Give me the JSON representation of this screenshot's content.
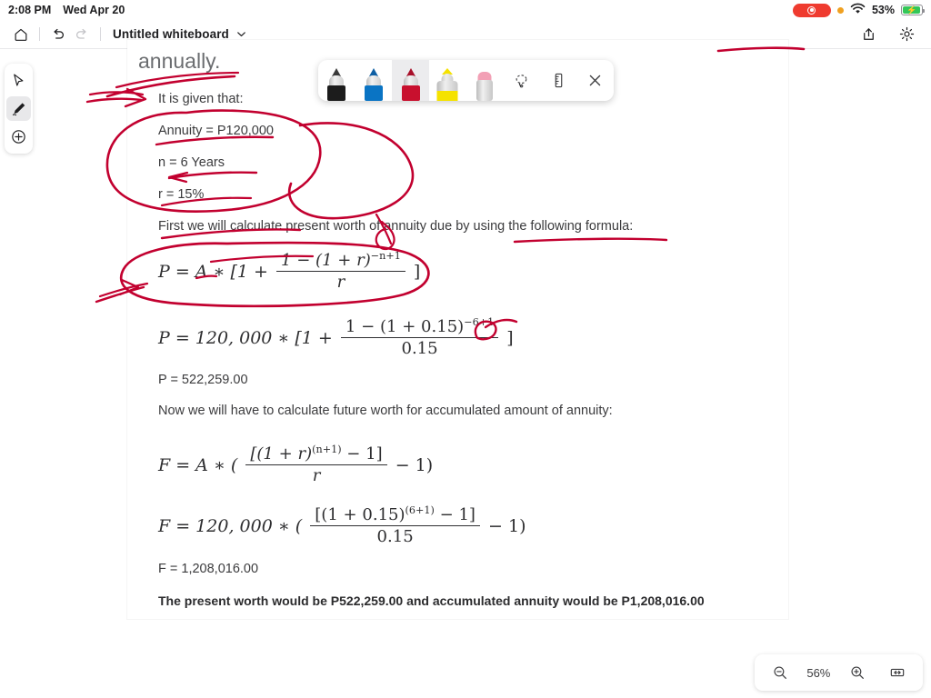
{
  "status_bar": {
    "time": "2:08 PM",
    "date": "Wed Apr 20",
    "battery_percent": "53%",
    "recording_icon": "screen-recording-indicator",
    "wifi_icon": "wifi-icon",
    "orange_dot_icon": "microphone-in-use-indicator",
    "battery_icon": "battery-charging-icon"
  },
  "app_toolbar": {
    "home_icon": "home-icon",
    "undo_icon": "undo-icon",
    "redo_icon": "redo-icon",
    "title": "Untitled whiteboard",
    "title_chevron_icon": "chevron-down-icon",
    "share_icon": "share-icon",
    "settings_icon": "gear-icon"
  },
  "tool_rail": {
    "items": [
      {
        "name": "select-tool",
        "icon": "cursor-arrow-icon",
        "active": false
      },
      {
        "name": "pen-tool",
        "icon": "pen-icon",
        "active": true
      },
      {
        "name": "add-tool",
        "icon": "plus-circle-icon",
        "active": false
      }
    ]
  },
  "pen_toolbar": {
    "pens": [
      {
        "label": "black-pen",
        "color": "#1c1c1c",
        "selected": false
      },
      {
        "label": "blue-pen",
        "color": "#0a74c4",
        "selected": false
      },
      {
        "label": "red-pen",
        "color": "#c8102e",
        "selected": true
      },
      {
        "label": "yellow-highlighter",
        "color": "#f5e200",
        "selected": false
      },
      {
        "label": "pink-eraser",
        "color": "#f2a0b5",
        "selected": false
      }
    ],
    "lasso_icon": "lasso-select-icon",
    "ruler_icon": "ruler-icon",
    "close_icon": "close-icon"
  },
  "document": {
    "heading_fragment": "annually.",
    "given_label": "It is given that:",
    "given": [
      "Annuity = P120,000",
      "n = 6 Years",
      "r = 15%"
    ],
    "present_worth_intro": "First we will calculate present worth of annuity due by using the following formula:",
    "formula_present_general": {
      "lhs": "P = A ∗ [1 +",
      "numerator": "1 − (1 + r)",
      "num_exponent": "−n+1",
      "denominator": "r",
      "rhs": "]"
    },
    "formula_present_numeric": {
      "lhs": "P = 120, 000 ∗ [1 +",
      "numerator": "1 − (1 + 0.15)",
      "num_exponent": "−6+1",
      "denominator": "0.15",
      "rhs": "]"
    },
    "present_result": "P = 522,259.00",
    "future_worth_intro": "Now we will have to calculate future worth for accumulated amount of annuity:",
    "formula_future_general": {
      "lhs": "F = A ∗ (",
      "numerator": "[(1 + r)",
      "num_exponent": "(n+1)",
      "num_tail": " − 1]",
      "denominator": "r",
      "rhs": "− 1)"
    },
    "formula_future_numeric": {
      "lhs": "F = 120, 000 ∗ (",
      "numerator": "[(1 + 0.15)",
      "num_exponent": "(6+1)",
      "num_tail": " − 1]",
      "denominator": "0.15",
      "rhs": "− 1)"
    },
    "future_result": "F = 1,208,016.00",
    "conclusion": "The present worth would be P522,259.00 and accumulated annuity would be P1,208,016.00"
  },
  "ink": {
    "color": "#c2002f",
    "annotations": [
      "underline-annually",
      "arrow-to-it-is-given",
      "oval-around-given-values",
      "underline-annuity",
      "underline-n-equals-6",
      "large-loop-right",
      "underline-first-sentence",
      "underline-following-formula",
      "oval-around-present-formula",
      "arrow-into-present-formula",
      "arrow-beside-numeric-formula",
      "stroke-top-right"
    ]
  },
  "zoom_bar": {
    "zoom_out_icon": "zoom-out-icon",
    "level": "56%",
    "zoom_in_icon": "zoom-in-icon",
    "fit_icon": "fit-to-width-icon"
  }
}
